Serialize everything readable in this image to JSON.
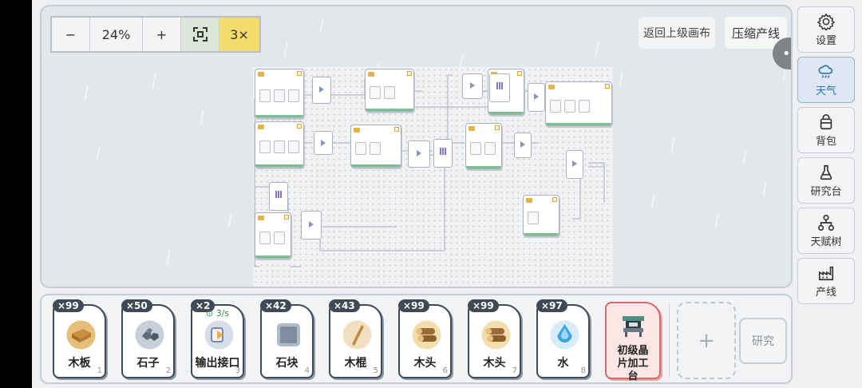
{
  "zoom": {
    "minus": "−",
    "value": "24%",
    "plus": "+",
    "speed": "3×"
  },
  "top_buttons": {
    "back": "返回上级画布",
    "compress": "压缩产线"
  },
  "capsule": {
    "more": "•••"
  },
  "sidebar": [
    {
      "id": "settings",
      "label": "设置",
      "icon": "gear-icon"
    },
    {
      "id": "weather",
      "label": "天气",
      "icon": "cloud-rain-icon",
      "active": true
    },
    {
      "id": "bag",
      "label": "背包",
      "icon": "bag-icon"
    },
    {
      "id": "research",
      "label": "研究台",
      "icon": "flask-icon"
    },
    {
      "id": "talent",
      "label": "天赋树",
      "icon": "tree-icon"
    },
    {
      "id": "line",
      "label": "产线",
      "icon": "factory-icon"
    }
  ],
  "inventory": [
    {
      "count": "×99",
      "name": "木板",
      "index": "1",
      "icon": "plank-icon",
      "color": "#e5bf7a"
    },
    {
      "count": "×50",
      "name": "石子",
      "index": "2",
      "icon": "pebble-icon",
      "color": "#c8cfd8"
    },
    {
      "count": "×2",
      "rate": "3/s",
      "name": "输出接口",
      "index": "3",
      "icon": "output-port-icon",
      "color": "#d5dde8"
    },
    {
      "count": "×42",
      "name": "石块",
      "index": "4",
      "icon": "stone-block-icon",
      "color": "#aebbc8"
    },
    {
      "count": "×43",
      "name": "木棍",
      "index": "5",
      "icon": "stick-icon",
      "color": "#f1e0c0"
    },
    {
      "count": "×99",
      "name": "木头",
      "index": "6",
      "icon": "log-icon",
      "color": "#f3dfae"
    },
    {
      "count": "×99",
      "name": "木头",
      "index": "7",
      "icon": "log-icon",
      "color": "#f3dfae"
    },
    {
      "count": "×97",
      "name": "水",
      "index": "8",
      "icon": "water-drop-icon",
      "color": "#d7ecf7"
    },
    {
      "name": "初级晶片加工台",
      "icon": "crystal-workbench-icon",
      "color": "#5a9b8c",
      "special": true
    }
  ],
  "add_label": "+",
  "research_label": "研究"
}
